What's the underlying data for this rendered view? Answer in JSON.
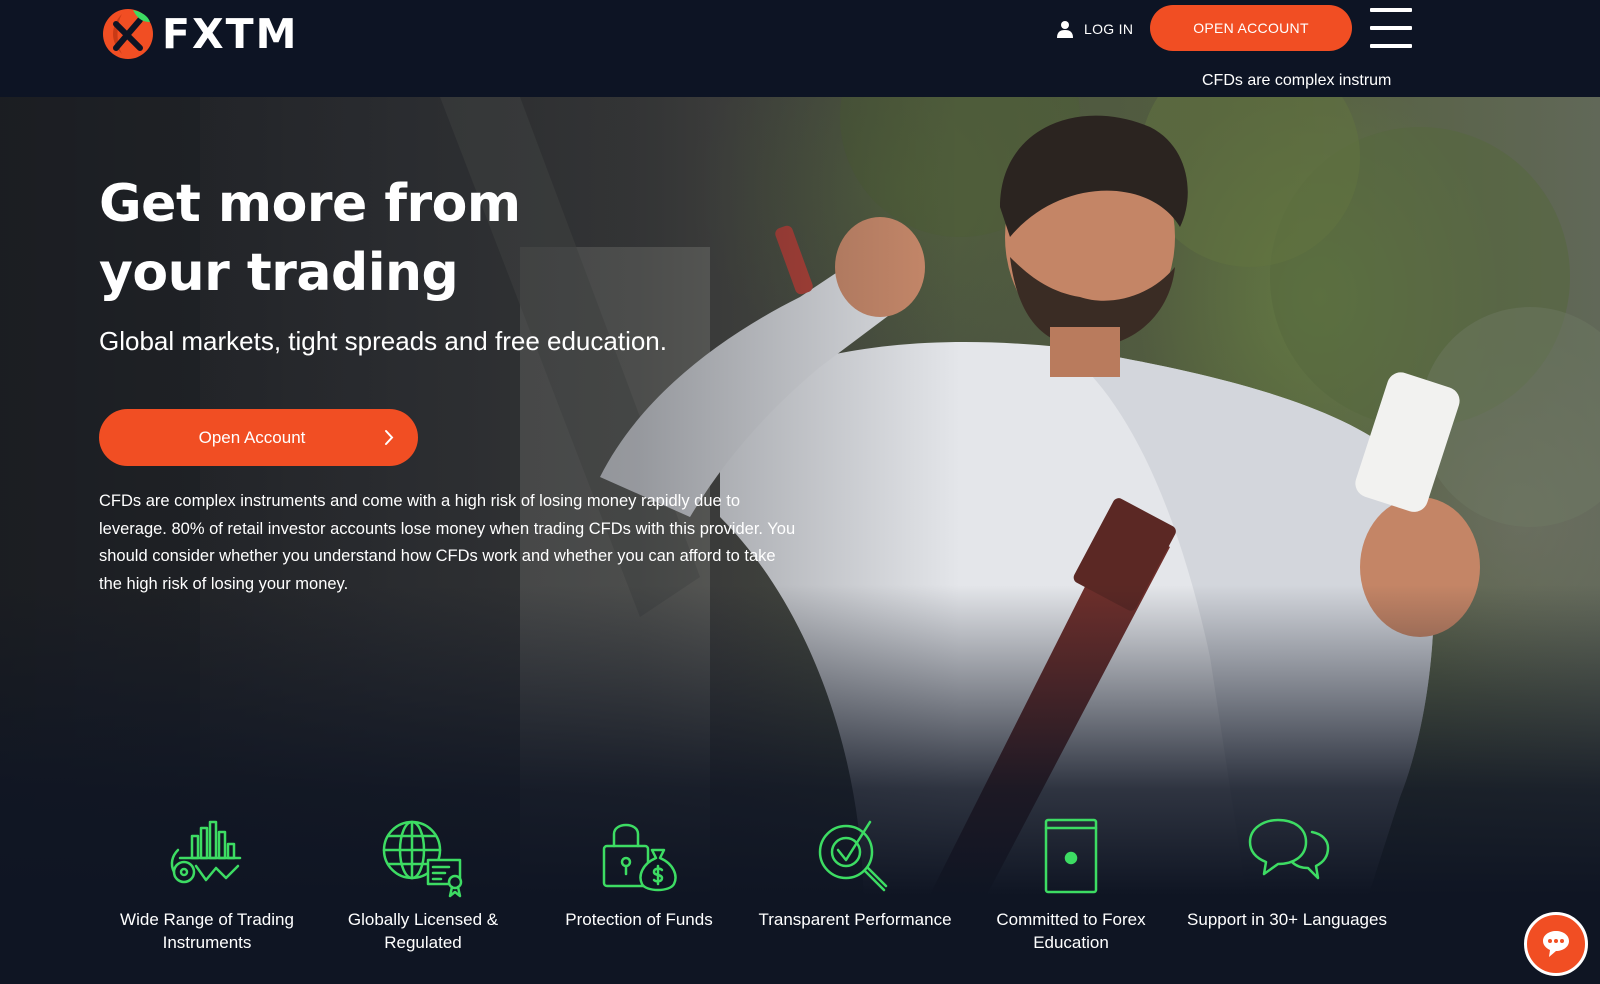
{
  "brand": {
    "name": "FXTM",
    "accent": "#f14e23",
    "feature_icon_color": "#3ddc63",
    "header_bg": "#0d1424"
  },
  "header": {
    "login_label": "LOG IN",
    "open_account_label": "OPEN ACCOUNT",
    "risk_strip": "CFDs are complex instrum"
  },
  "hero": {
    "headline": "Get more from your trading",
    "subheadline": "Global markets, tight spreads and free education.",
    "cta_label": "Open Account",
    "risk_warning": "CFDs are complex instruments and come with a high risk of losing money rapidly due to leverage. 80% of retail investor accounts lose money when trading CFDs with this provider. You should consider whether you understand how CFDs work and whether you can afford to take the high risk of losing your money."
  },
  "features": [
    {
      "label": "Wide Range of Trading Instruments",
      "icon": "chart-bars-icon"
    },
    {
      "label": "Globally Licensed & Regulated",
      "icon": "globe-certificate-icon"
    },
    {
      "label": "Protection of Funds",
      "icon": "padlock-moneybag-icon"
    },
    {
      "label": "Transparent Performance",
      "icon": "magnifier-check-icon"
    },
    {
      "label": "Committed to Forex Education",
      "icon": "book-icon"
    },
    {
      "label": "Support in 30+ Languages",
      "icon": "speech-bubbles-icon"
    }
  ],
  "icons": {
    "user": "user-icon",
    "menu": "hamburger-icon",
    "chevron": "chevron-right-icon",
    "chat": "chat-icon"
  }
}
